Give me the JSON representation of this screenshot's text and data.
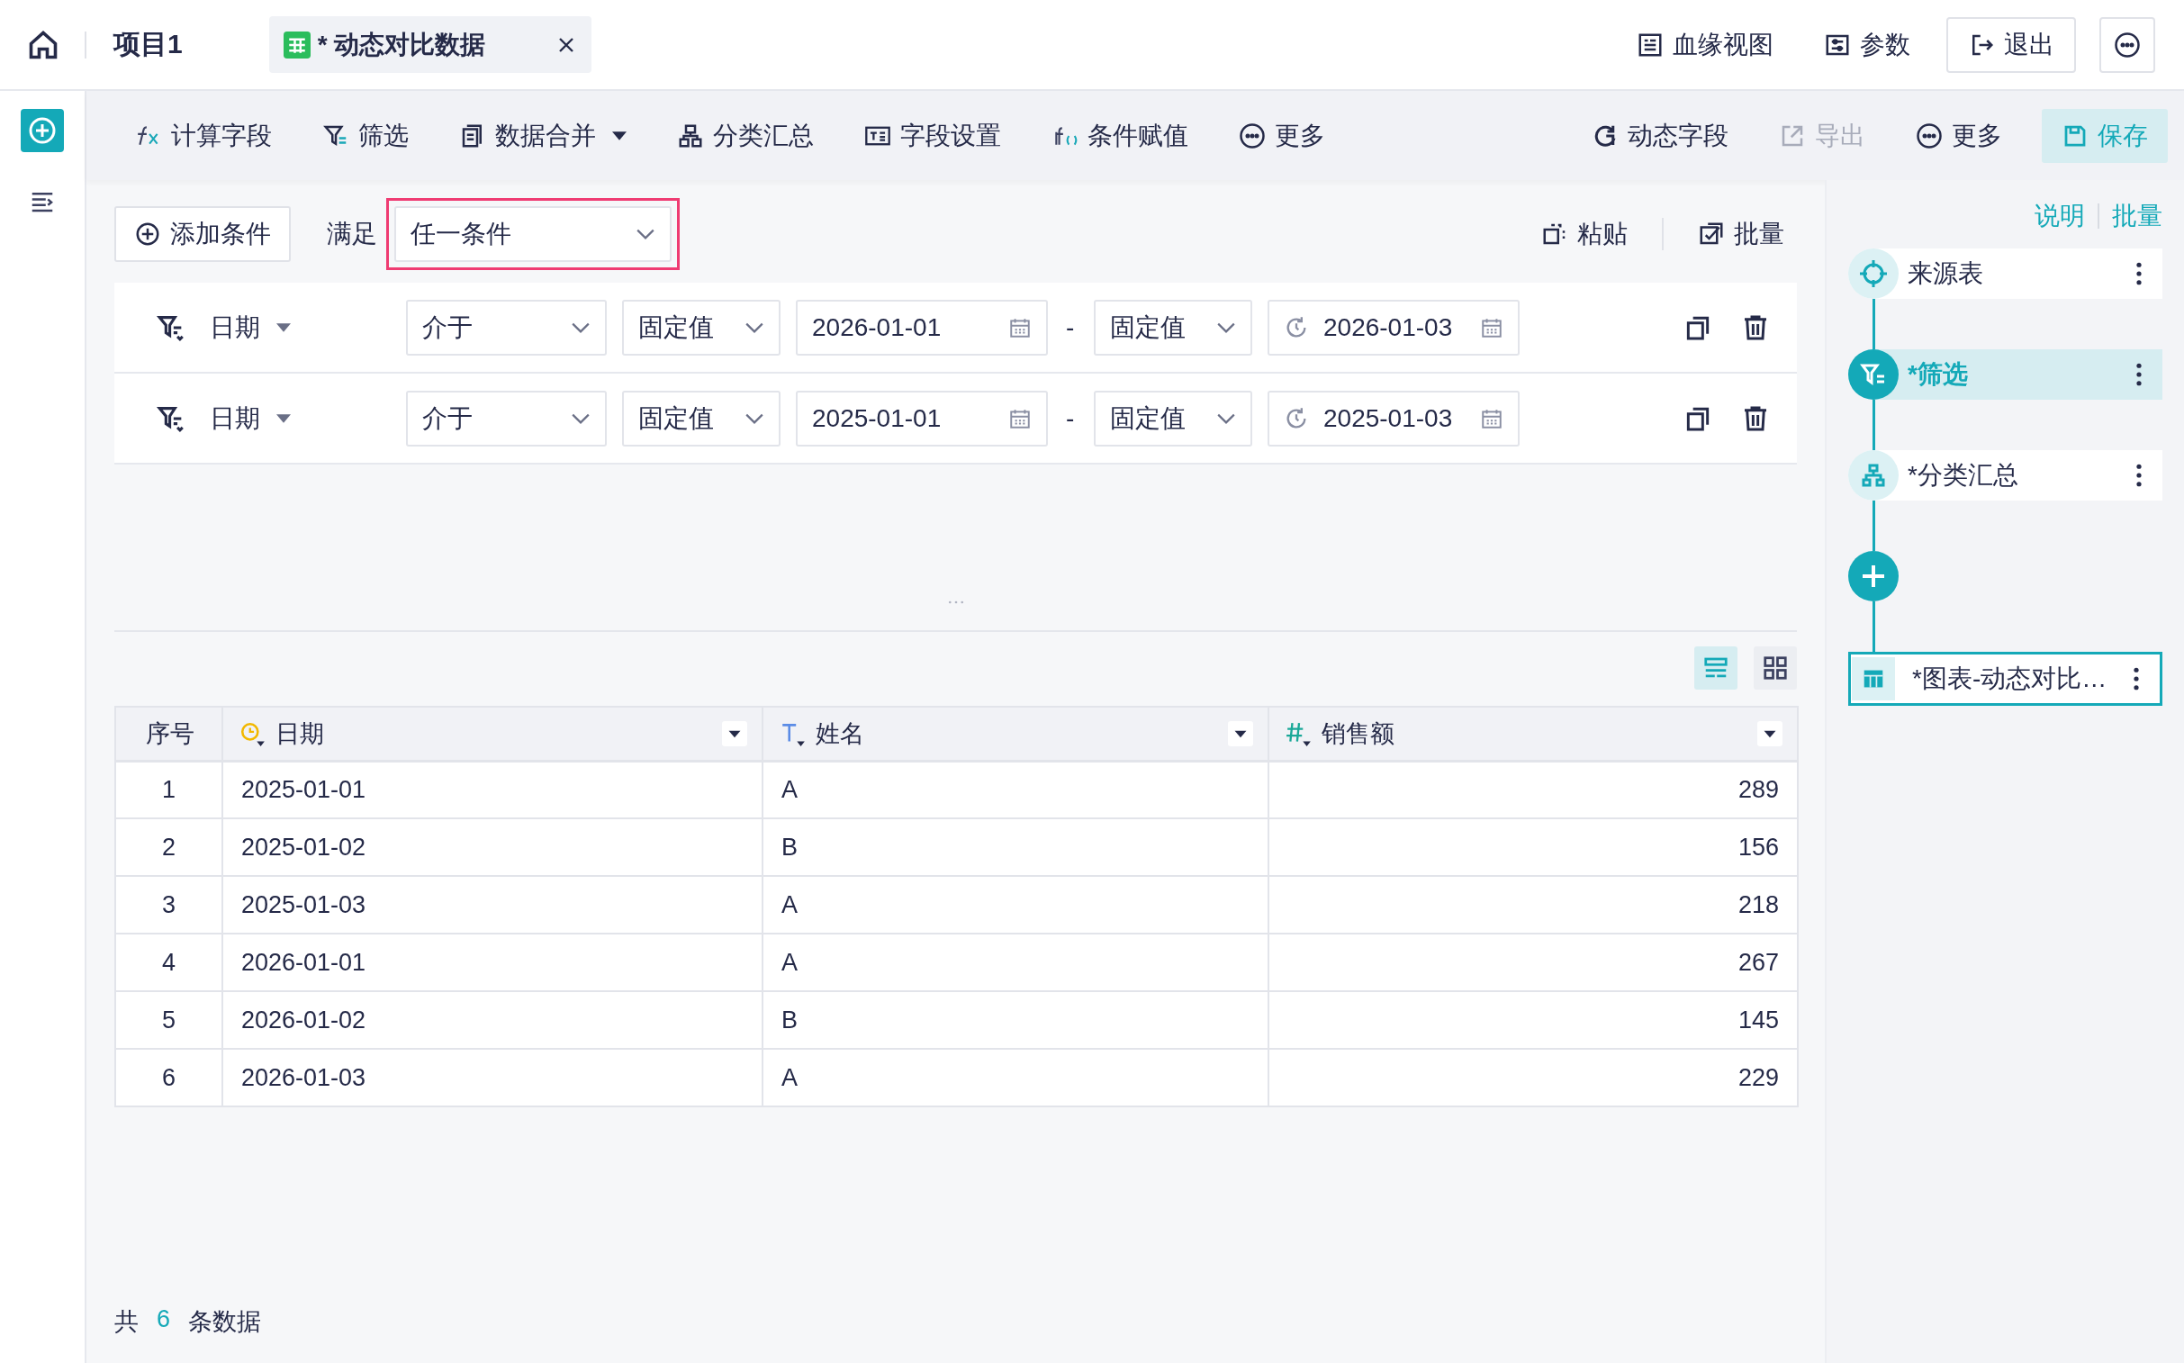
{
  "top_bar": {
    "project": "项目1",
    "tab": {
      "title": "* 动态对比数据"
    },
    "actions": [
      {
        "kind": "lineage",
        "label": "血缘视图"
      },
      {
        "kind": "params",
        "label": "参数"
      },
      {
        "kind": "exit",
        "label": "退出"
      },
      {
        "kind": "more"
      }
    ]
  },
  "toolbar": {
    "left": [
      {
        "kind": "fx",
        "label": "计算字段",
        "has_menu": false
      },
      {
        "kind": "filter",
        "label": "筛选",
        "has_menu": false
      },
      {
        "kind": "merge",
        "label": "数据合并",
        "has_menu": true
      },
      {
        "kind": "group",
        "label": "分类汇总",
        "has_menu": false
      },
      {
        "kind": "fields",
        "label": "字段设置",
        "has_menu": false
      },
      {
        "kind": "if",
        "label": "条件赋值",
        "has_menu": false
      },
      {
        "kind": "more",
        "label": "更多",
        "has_menu": false
      }
    ],
    "right": [
      {
        "kind": "dynamic",
        "label": "动态字段",
        "disabled": false
      },
      {
        "kind": "export",
        "label": "导出",
        "disabled": true
      },
      {
        "kind": "more",
        "label": "更多",
        "disabled": false
      },
      {
        "kind": "save",
        "label": "保存",
        "disabled": false
      }
    ]
  },
  "conditions": {
    "add_button": "添加条件",
    "match_label": "满足",
    "match": {
      "value": "任一条件",
      "highlighted": true
    },
    "paste": "粘贴",
    "batch": "批量",
    "filters": [
      {
        "field": "日期",
        "operator": "介于",
        "from_mode": "固定值",
        "from": "2026-01-01",
        "separator": "-",
        "to_mode": "固定值",
        "to": "2026-01-03"
      },
      {
        "field": "日期",
        "operator": "介于",
        "from_mode": "固定值",
        "from": "2025-01-01",
        "separator": "-",
        "to_mode": "固定值",
        "to": "2025-01-03"
      }
    ]
  },
  "view_toggle": [
    {
      "kind": "list",
      "selected": true
    },
    {
      "kind": "grid",
      "selected": false
    }
  ],
  "table": {
    "columns": [
      {
        "kind": "index",
        "label": "序号"
      },
      {
        "kind": "date",
        "label": "日期"
      },
      {
        "kind": "text",
        "label": "姓名"
      },
      {
        "kind": "number",
        "label": "销售额"
      }
    ],
    "rows": [
      [
        "1",
        "2025-01-01",
        "A",
        "289"
      ],
      [
        "2",
        "2025-01-02",
        "B",
        "156"
      ],
      [
        "3",
        "2025-01-03",
        "A",
        "218"
      ],
      [
        "4",
        "2026-01-01",
        "A",
        "267"
      ],
      [
        "5",
        "2026-01-02",
        "B",
        "145"
      ],
      [
        "6",
        "2026-01-03",
        "A",
        "229"
      ]
    ]
  },
  "footer": {
    "prefix": "共",
    "count": "6",
    "suffix": "条数据"
  },
  "side_panel": {
    "links": [
      "说明",
      "批量"
    ],
    "flow": [
      {
        "kind": "source",
        "label": "来源表",
        "selected": false
      },
      {
        "kind": "filter",
        "label": "*筛选",
        "selected": true
      },
      {
        "kind": "group",
        "label": "*分类汇总",
        "selected": false
      },
      {
        "kind": "add"
      },
      {
        "kind": "chart",
        "label": "*图表-动态对比…",
        "selected": false
      }
    ]
  }
}
